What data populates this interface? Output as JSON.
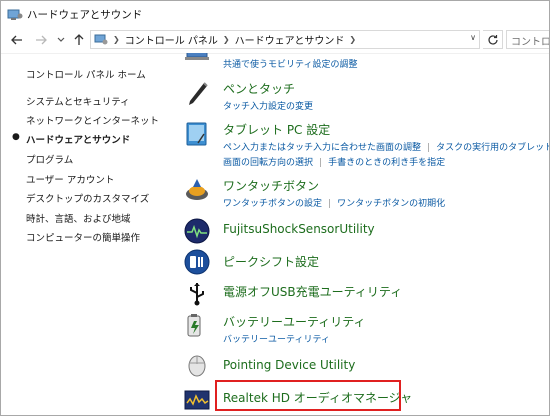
{
  "window": {
    "title": "ハードウェアとサウンド"
  },
  "address": {
    "crumbs": [
      "コントロール パネル",
      "ハードウェアとサウンド"
    ],
    "search_placeholder": "コントロール パネ"
  },
  "sidebar": {
    "items": [
      {
        "label": "コントロール パネル ホーム",
        "active": false
      },
      {
        "label": "システムとセキュリティ",
        "active": false
      },
      {
        "label": "ネットワークとインターネット",
        "active": false
      },
      {
        "label": "ハードウェアとサウンド",
        "active": true
      },
      {
        "label": "プログラム",
        "active": false
      },
      {
        "label": "ユーザー アカウント",
        "active": false
      },
      {
        "label": "デスクトップのカスタマイズ",
        "active": false
      },
      {
        "label": "時計、言語、および地域",
        "active": false
      },
      {
        "label": "コンピューターの簡単操作",
        "active": false
      }
    ]
  },
  "categories": [
    {
      "title": "",
      "icon": "mobility-icon",
      "links": [
        "共通で使うモビリティ設定の調整"
      ]
    },
    {
      "title": "ペンとタッチ",
      "icon": "pen-icon",
      "links": [
        "タッチ入力設定の変更"
      ]
    },
    {
      "title": "タブレット PC 設定",
      "icon": "tablet-icon",
      "links": [
        "ペン入力またはタッチ入力に合わせた画面の調整",
        "タスクの実行用のタブレット ボタ",
        "画面の回転方向の選択",
        "手書きのときの利き手を指定"
      ]
    },
    {
      "title": "ワンタッチボタン",
      "icon": "onetouch-button-icon",
      "links": [
        "ワンタッチボタンの設定",
        "ワンタッチボタンの初期化"
      ]
    },
    {
      "title": "FujitsuShockSensorUtility",
      "icon": "shock-sensor-icon",
      "links": []
    },
    {
      "title": "ピークシフト設定",
      "icon": "peak-shift-icon",
      "links": []
    },
    {
      "title": "電源オフUSB充電ユーティリティ",
      "icon": "usb-icon",
      "links": []
    },
    {
      "title": "バッテリーユーティリティ",
      "icon": "battery-icon",
      "links": [
        "バッテリーユーティリティ"
      ]
    },
    {
      "title": "Pointing Device Utility",
      "icon": "mouse-icon",
      "links": []
    },
    {
      "title": "Realtek HD オーディオマネージャ",
      "icon": "realtek-audio-icon",
      "links": []
    }
  ],
  "colors": {
    "category_title": "#1d6d1d",
    "link": "#0b5aa3",
    "highlight": "#e02020"
  }
}
